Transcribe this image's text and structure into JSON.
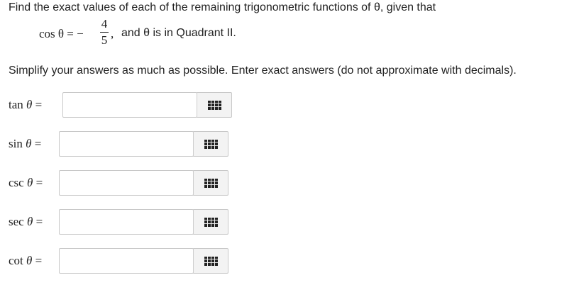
{
  "question": {
    "intro_text": "Find the exact values of each of the remaining trigonometric functions of θ, given that",
    "given": {
      "lhs": "cos θ = −",
      "numerator": "4",
      "denominator": "5",
      "comma": ",",
      "rest": "and θ is in Quadrant II."
    },
    "instructions": "Simplify your answers as much as possible. Enter exact answers (do not approximate with decimals)."
  },
  "answers": [
    {
      "func": "tan",
      "symbol": "θ",
      "equals": "=",
      "value": ""
    },
    {
      "func": "sin",
      "symbol": "θ",
      "equals": "=",
      "value": ""
    },
    {
      "func": "csc",
      "symbol": "θ",
      "equals": "=",
      "value": ""
    },
    {
      "func": "sec",
      "symbol": "θ",
      "equals": "=",
      "value": ""
    },
    {
      "func": "cot",
      "symbol": "θ",
      "equals": "=",
      "value": ""
    }
  ],
  "icons": {
    "keyboard": "keypad-grid-icon"
  }
}
